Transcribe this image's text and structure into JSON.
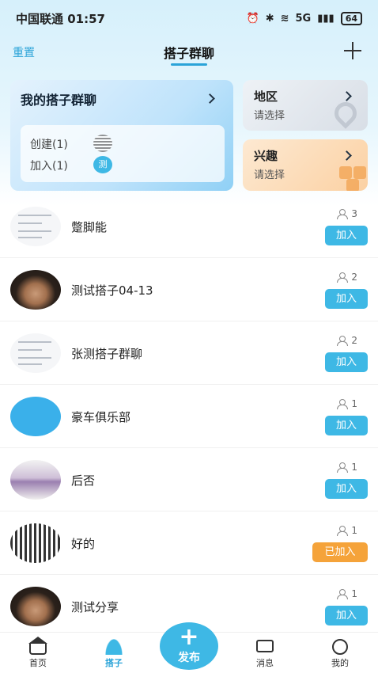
{
  "status": {
    "carrier_time": "中国联通 01:57",
    "network": "5G",
    "battery": "64"
  },
  "nav": {
    "reset": "重置",
    "title": "搭子群聊"
  },
  "my_groups": {
    "title": "我的搭子群聊",
    "created": "创建(1)",
    "joined": "加入(1)",
    "joined_avatar": "测"
  },
  "filters": {
    "region": {
      "title": "地区",
      "placeholder": "请选择"
    },
    "interest": {
      "title": "兴趣",
      "placeholder": "请选择"
    }
  },
  "groups": [
    {
      "name": "蹩脚能",
      "members": "3",
      "action": "加入",
      "thumb": "doc",
      "state": "join"
    },
    {
      "name": "测试搭子04-13",
      "members": "2",
      "action": "加入",
      "thumb": "face",
      "state": "join"
    },
    {
      "name": "张测搭子群聊",
      "members": "2",
      "action": "加入",
      "thumb": "doc",
      "state": "join"
    },
    {
      "name": "豪车俱乐部",
      "members": "1",
      "action": "加入",
      "thumb": "blue",
      "state": "join"
    },
    {
      "name": "后否",
      "members": "1",
      "action": "加入",
      "thumb": "photo",
      "state": "join"
    },
    {
      "name": "好的",
      "members": "1",
      "action": "已加入",
      "thumb": "qr",
      "state": "joined"
    },
    {
      "name": "测试分享",
      "members": "1",
      "action": "加入",
      "thumb": "face",
      "state": "join"
    }
  ],
  "tabbar": {
    "home": "首页",
    "partner": "搭子",
    "publish": "发布",
    "messages": "消息",
    "me": "我的"
  },
  "colors": {
    "accent": "#3eb8e5",
    "joined": "#f5a33a"
  }
}
